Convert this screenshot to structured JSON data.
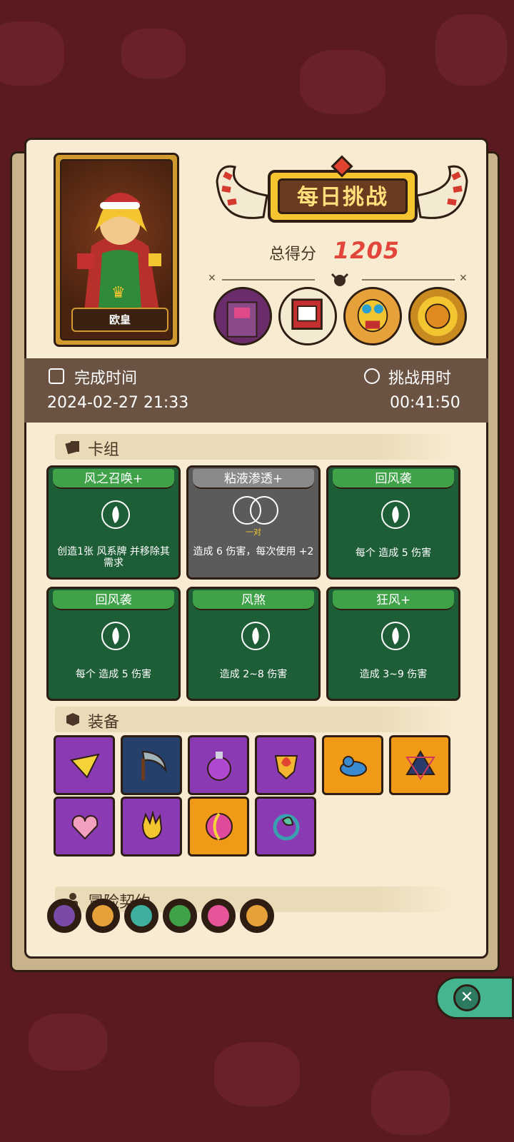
{
  "header": {
    "title": "每日挑战",
    "score_label": "总得分",
    "score_value": "1205"
  },
  "hero": {
    "name": "欧皇"
  },
  "bosses": [
    {
      "icon": "stone-golem-boss-icon",
      "color": "#6a2c6a"
    },
    {
      "icon": "cage-box-boss-icon",
      "color": "#c43030"
    },
    {
      "icon": "skull-mask-boss-icon",
      "color": "#e6a13a"
    },
    {
      "icon": "sun-face-boss-icon",
      "color": "#e0b020"
    }
  ],
  "info": {
    "finish_time_label": "完成时间",
    "finish_time_value": "2024-02-27 21:33",
    "duration_label": "挑战用时",
    "duration_value": "00:41:50"
  },
  "deck": {
    "title": "卡组",
    "cards": [
      {
        "name": "风之召唤+",
        "desc": "创造1张 风系牌 并移除其需求",
        "type": "wind",
        "color": "#1d5e37"
      },
      {
        "name": "粘液渗透+",
        "sub": "一对",
        "desc": "造成 6 伤害，每次使用 +2",
        "type": "pair",
        "color": "#5b5b5b"
      },
      {
        "name": "回风袭",
        "desc": "每个 造成 5 伤害",
        "type": "wind",
        "color": "#1d5e37"
      },
      {
        "name": "回风袭",
        "desc": "每个 造成 5 伤害",
        "type": "wind",
        "color": "#1d5e37"
      },
      {
        "name": "风煞",
        "desc": "造成 2~8 伤害",
        "type": "wind",
        "color": "#1d5e37"
      },
      {
        "name": "狂风+",
        "desc": "造成 3~9 伤害",
        "type": "wind",
        "color": "#1d5e37"
      }
    ]
  },
  "equipment": {
    "title": "装备",
    "items": [
      {
        "icon": "cheese-wedge-icon",
        "bg": "purple"
      },
      {
        "icon": "scythe-icon",
        "bg": "blue"
      },
      {
        "icon": "potion-flask-icon",
        "bg": "purple"
      },
      {
        "icon": "fire-shield-icon",
        "bg": "purple"
      },
      {
        "icon": "blue-slime-icon",
        "bg": "orange"
      },
      {
        "icon": "hexagram-amulet-icon",
        "bg": "orange"
      },
      {
        "icon": "heart-locket-icon",
        "bg": "purple"
      },
      {
        "icon": "golden-glove-icon",
        "bg": "purple"
      },
      {
        "icon": "yin-yang-orb-icon",
        "bg": "orange"
      },
      {
        "icon": "leaf-ring-icon",
        "bg": "purple"
      }
    ]
  },
  "contracts": {
    "title": "冒险契约",
    "items": [
      {
        "icon": "purple-heart-contract-icon",
        "color": "#7a4aa8"
      },
      {
        "icon": "horn-contract-icon",
        "color": "#e6a13a"
      },
      {
        "icon": "crystal-contract-icon",
        "color": "#3fb0a0"
      },
      {
        "icon": "bottle-contract-icon",
        "color": "#3fa248"
      },
      {
        "icon": "flower-contract-icon",
        "color": "#e6559a"
      },
      {
        "icon": "fist-contract-icon",
        "color": "#e6a13a"
      }
    ]
  },
  "close_label": "✕"
}
